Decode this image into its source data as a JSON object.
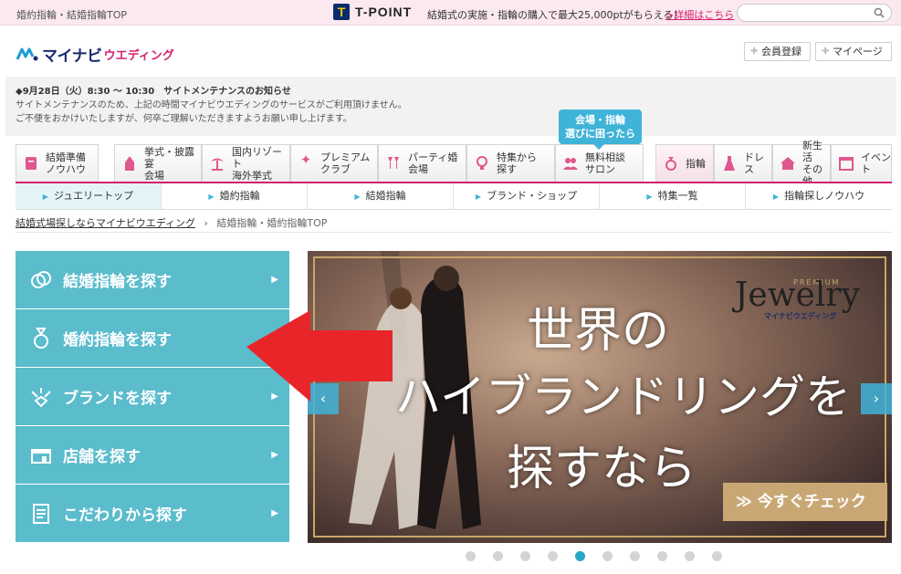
{
  "topbar": {
    "breadcrumb": "婚約指輪・結婚指輪TOP",
    "tpoint_logo": "T",
    "tpoint_name": "T-POINT",
    "message": "結婚式の実施・指輪の購入で最大25,000ptがもらえる！",
    "link": ">詳細はこちら",
    "search_placeholder": ""
  },
  "header": {
    "logo_text": "マイナビ",
    "logo_sub": "ウエディング",
    "register": "会員登録",
    "mypage": "マイページ"
  },
  "notice": {
    "title": "◆9月28日（火）8:30 ～ 10:30　サイトメンテナンスのお知らせ",
    "line1": "サイトメンテナンスのため、上記の時間マイナビウエディングのサービスがご利用頂けません。",
    "line2": "ご不便をおかけいたしますが、何卒ご理解いただきますようお願い申し上げます。"
  },
  "tooltip": {
    "line1": "会場・指輪",
    "line2": "選びに困ったら"
  },
  "nav": {
    "items": [
      {
        "line1": "結婚準備",
        "line2": "ノウハウ"
      },
      {
        "line1": "挙式・披露宴",
        "line2": "会場"
      },
      {
        "line1": "国内リゾート",
        "line2": "海外挙式"
      },
      {
        "line1": "プレミアム",
        "line2": "クラブ"
      },
      {
        "line1": "パーティ婚",
        "line2": "会場"
      },
      {
        "line1": "特集から",
        "line2": "探す"
      },
      {
        "line1": "無料相談",
        "line2": "サロン"
      },
      {
        "line1": "指輪",
        "line2": ""
      },
      {
        "line1": "ドレス",
        "line2": ""
      },
      {
        "line1": "新生活",
        "line2": "その他"
      },
      {
        "line1": "イベント",
        "line2": ""
      }
    ]
  },
  "subnav": {
    "items": [
      "ジュエリートップ",
      "婚約指輪",
      "結婚指輪",
      "ブランド・ショップ",
      "特集一覧",
      "指輪探しノウハウ"
    ]
  },
  "breadcrumb": {
    "home": "結婚式場探しならマイナビウエディング",
    "sep": "›",
    "current": "結婚指輪・婚約指輪TOP"
  },
  "leftmenu": {
    "items": [
      "結婚指輪を探す",
      "婚約指輪を探す",
      "ブランドを探す",
      "店舗を探す",
      "こだわりから探す"
    ]
  },
  "banner": {
    "premium": "PREMIUM",
    "jewelry": "Jewelry",
    "jewelry_sub": "マイナビウエディング",
    "line1": "世界の",
    "line2": "ハイブランドリングを",
    "line3": "探すなら",
    "cta": "≫ 今すぐチェック",
    "prev": "‹",
    "next": "›"
  },
  "carousel": {
    "total": 10,
    "active": 5
  },
  "colors": {
    "accent_pink": "#d6206e",
    "menu_teal": "#5bbccc",
    "tip_blue": "#3fb3d8",
    "arrow_red": "#e8262a"
  }
}
